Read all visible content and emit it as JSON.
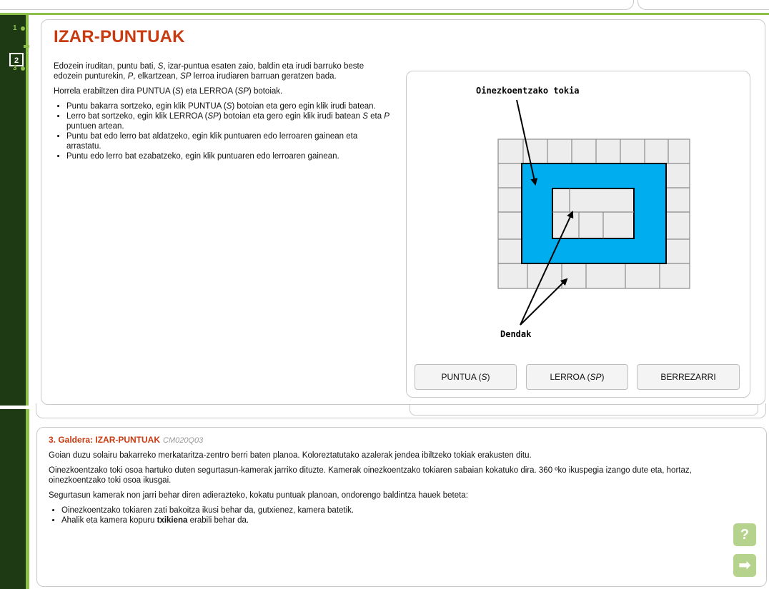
{
  "navigation": {
    "steps": [
      "1",
      "2",
      "3"
    ],
    "current": "2"
  },
  "stimulus": {
    "title": "IZAR-PUNTUAK",
    "paragraph1": "Edozein iruditan, puntu bati, S, izar-puntua esaten zaio, baldin eta irudi barruko beste edozein punturekin, P, elkartzean, SP lerroa irudiaren barruan geratzen bada.",
    "paragraph2": "Horrela erabiltzen dira PUNTUA (S) eta LERROA (SP) botoiak.",
    "bullets": [
      "Puntu bakarra sortzeko, egin klik PUNTUA (S) botoian eta gero egin klik irudi batean.",
      "Lerro bat sortzeko, egin klik LERROA (SP) botoian eta gero egin klik irudi batean S eta P puntuen artean.",
      "Puntu bat edo lerro bat aldatzeko, egin klik puntuaren edo lerroaren gainean eta arrastatu.",
      "Puntu edo lerro bat ezabatzeko, egin klik puntuaren edo lerroaren gainean."
    ]
  },
  "figure": {
    "label_top": "Oinezkoentzako tokia",
    "label_bottom": "Dendak",
    "colors": {
      "pedestrian_area": "#00aeef",
      "shop": "#ededed",
      "outline": "#000000"
    }
  },
  "buttons": {
    "point": "PUNTUA (S)",
    "line": "LERROA (SP)",
    "reset": "BERREZARRI"
  },
  "question": {
    "heading": "3. Galdera: IZAR-PUNTUAK",
    "code": "CM020Q03",
    "paragraph1": "Goian duzu solairu bakarreko merkataritza-zentro berri baten planoa. Koloreztatutako azalerak jendea ibiltzeko tokiak erakusten ditu.",
    "paragraph2": "Oinezkoentzako toki osoa hartuko duten segurtasun-kamerak jarriko dituzte. Kamerak oinezkoentzako tokiaren sabaian kokatuko dira. 360 ºko ikuspegia izango dute eta, hortaz, oinezkoentzako toki osoa ikusgai.",
    "paragraph3": "Segurtasun kamerak non jarri behar diren adierazteko, kokatu puntuak planoan, ondorengo baldintza hauek beteta:",
    "bullet1": "Oinezkoentzako tokiaren zati bakoitza ikusi behar da, gutxienez, kamera batetik.",
    "bullet2_pre": "Ahalik eta kamera kopuru ",
    "bullet2_bold": "txikiena",
    "bullet2_post": " erabili behar da."
  },
  "controls": {
    "help_icon": "?",
    "next_icon": "➡"
  },
  "accent_colors": {
    "sidebar": "#1d3a14",
    "green": "#8cc04a",
    "title_red": "#c83a10"
  }
}
